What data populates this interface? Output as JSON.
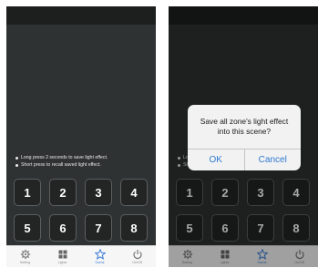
{
  "hints": [
    "Long press 2 seconds to save light effect.",
    "Short press to recall saved light effect."
  ],
  "keys": [
    "1",
    "2",
    "3",
    "4",
    "5",
    "6",
    "7",
    "8"
  ],
  "tabs": [
    {
      "label": "Setting",
      "icon": "gear-icon"
    },
    {
      "label": "Lights",
      "icon": "lights-grid-icon"
    },
    {
      "label": "Scene",
      "icon": "star-icon",
      "active": true
    },
    {
      "label": "On/Off",
      "icon": "power-icon"
    }
  ],
  "dialog": {
    "message": "Save all zone's light effect into this scene?",
    "ok_label": "OK",
    "cancel_label": "Cancel"
  },
  "colors": {
    "accent": "#2e7ad1",
    "screen_bg": "#2f3232",
    "key_bg": "#232525",
    "tabbar_bg": "#f6f6f6"
  }
}
